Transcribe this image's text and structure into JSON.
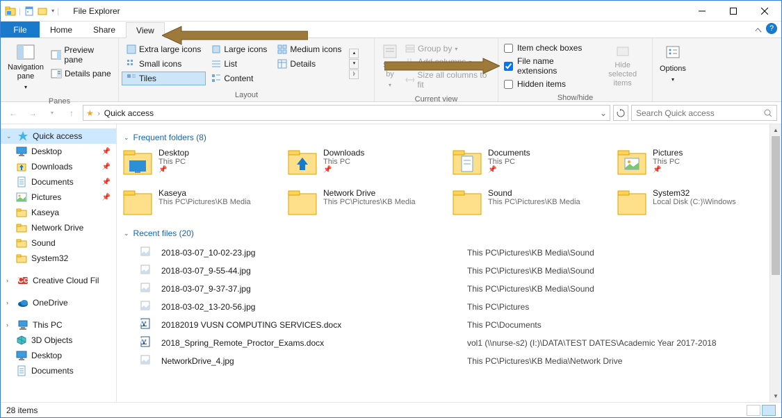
{
  "window": {
    "title": "File Explorer"
  },
  "tabs": {
    "file": "File",
    "home": "Home",
    "share": "Share",
    "view": "View"
  },
  "ribbon": {
    "panes": {
      "nav": "Navigation\npane",
      "preview": "Preview pane",
      "details": "Details pane",
      "group": "Panes"
    },
    "layout": {
      "xl": "Extra large icons",
      "large": "Large icons",
      "medium": "Medium icons",
      "small": "Small icons",
      "list": "List",
      "details": "Details",
      "tiles": "Tiles",
      "content": "Content",
      "group": "Layout"
    },
    "current": {
      "sort": "Sort\nby",
      "groupby": "Group by",
      "addcols": "Add columns",
      "sizecols": "Size all columns to fit",
      "group": "Current view"
    },
    "showhide": {
      "itemcheck": "Item check boxes",
      "fileext": "File name extensions",
      "hidden": "Hidden items",
      "hidesel": "Hide selected\nitems",
      "group": "Show/hide"
    },
    "options": "Options"
  },
  "address": {
    "text": "Quick access"
  },
  "search": {
    "placeholder": "Search Quick access"
  },
  "sidebar": [
    {
      "icon": "star",
      "label": "Quick access",
      "lvl": 0,
      "sel": true
    },
    {
      "icon": "desktop",
      "label": "Desktop",
      "lvl": 1,
      "pin": true
    },
    {
      "icon": "downloads",
      "label": "Downloads",
      "lvl": 1,
      "pin": true
    },
    {
      "icon": "documents",
      "label": "Documents",
      "lvl": 1,
      "pin": true
    },
    {
      "icon": "pictures",
      "label": "Pictures",
      "lvl": 1,
      "pin": true
    },
    {
      "icon": "folder",
      "label": "Kaseya",
      "lvl": 1
    },
    {
      "icon": "folder",
      "label": "Network Drive",
      "lvl": 1
    },
    {
      "icon": "folder",
      "label": "Sound",
      "lvl": 1
    },
    {
      "icon": "folder",
      "label": "System32",
      "lvl": 1
    },
    {
      "sep": true
    },
    {
      "icon": "cc",
      "label": "Creative Cloud Fil",
      "lvl": 0
    },
    {
      "sep": true
    },
    {
      "icon": "onedrive",
      "label": "OneDrive",
      "lvl": 0
    },
    {
      "sep": true
    },
    {
      "icon": "thispc",
      "label": "This PC",
      "lvl": 0
    },
    {
      "icon": "3d",
      "label": "3D Objects",
      "lvl": 1
    },
    {
      "icon": "desktop",
      "label": "Desktop",
      "lvl": 1
    },
    {
      "icon": "documents",
      "label": "Documents",
      "lvl": 1
    }
  ],
  "sections": {
    "freq": {
      "title": "Frequent folders (8)",
      "items": [
        {
          "name": "Desktop",
          "path": "This PC",
          "type": "desktop",
          "pin": true
        },
        {
          "name": "Downloads",
          "path": "This PC",
          "type": "downloads",
          "pin": true
        },
        {
          "name": "Documents",
          "path": "This PC",
          "type": "documents",
          "pin": true
        },
        {
          "name": "Pictures",
          "path": "This PC",
          "type": "pictures",
          "pin": true
        },
        {
          "name": "Kaseya",
          "path": "This PC\\Pictures\\KB Media",
          "type": "folder"
        },
        {
          "name": "Network Drive",
          "path": "This PC\\Pictures\\KB Media",
          "type": "folder"
        },
        {
          "name": "Sound",
          "path": "This PC\\Pictures\\KB Media",
          "type": "folder"
        },
        {
          "name": "System32",
          "path": "Local Disk (C:)\\Windows",
          "type": "folder"
        }
      ]
    },
    "recent": {
      "title": "Recent files (20)",
      "items": [
        {
          "ico": "img",
          "name": "2018-03-07_10-02-23.jpg",
          "path": "This PC\\Pictures\\KB Media\\Sound"
        },
        {
          "ico": "img",
          "name": "2018-03-07_9-55-44.jpg",
          "path": "This PC\\Pictures\\KB Media\\Sound"
        },
        {
          "ico": "img",
          "name": "2018-03-07_9-37-37.jpg",
          "path": "This PC\\Pictures\\KB Media\\Sound"
        },
        {
          "ico": "img",
          "name": "2018-03-02_13-20-56.jpg",
          "path": "This PC\\Pictures"
        },
        {
          "ico": "docx",
          "name": "20182019 VUSN COMPUTING SERVICES.docx",
          "path": "This PC\\Documents"
        },
        {
          "ico": "docx",
          "name": "2018_Spring_Remote_Proctor_Exams.docx",
          "path": "vol1 (\\\\nurse-s2) (I:)\\DATA\\TEST DATES\\Academic Year 2017-2018"
        },
        {
          "ico": "img",
          "name": "NetworkDrive_4.jpg",
          "path": "This PC\\Pictures\\KB Media\\Network Drive"
        }
      ]
    }
  },
  "status": {
    "count": "28 items"
  }
}
